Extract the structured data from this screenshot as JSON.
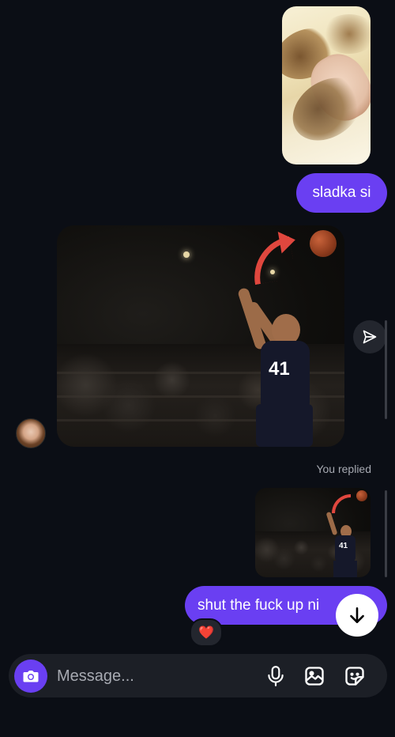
{
  "messages": {
    "sent_text_1": "sladka si",
    "you_replied_label": "You replied",
    "sent_text_2": "shut the fuck up ni",
    "reaction_emoji": "❤️"
  },
  "post": {
    "jersey_number": "41"
  },
  "composer": {
    "placeholder": "Message...",
    "icons": [
      "camera-icon",
      "microphone-icon",
      "gallery-icon",
      "sticker-icon"
    ]
  },
  "colors": {
    "background": "#0b0e15",
    "bubble_accent": "#6a3ff2",
    "composer_bg": "#1c1f26",
    "reaction_heart": "#ff3040"
  }
}
